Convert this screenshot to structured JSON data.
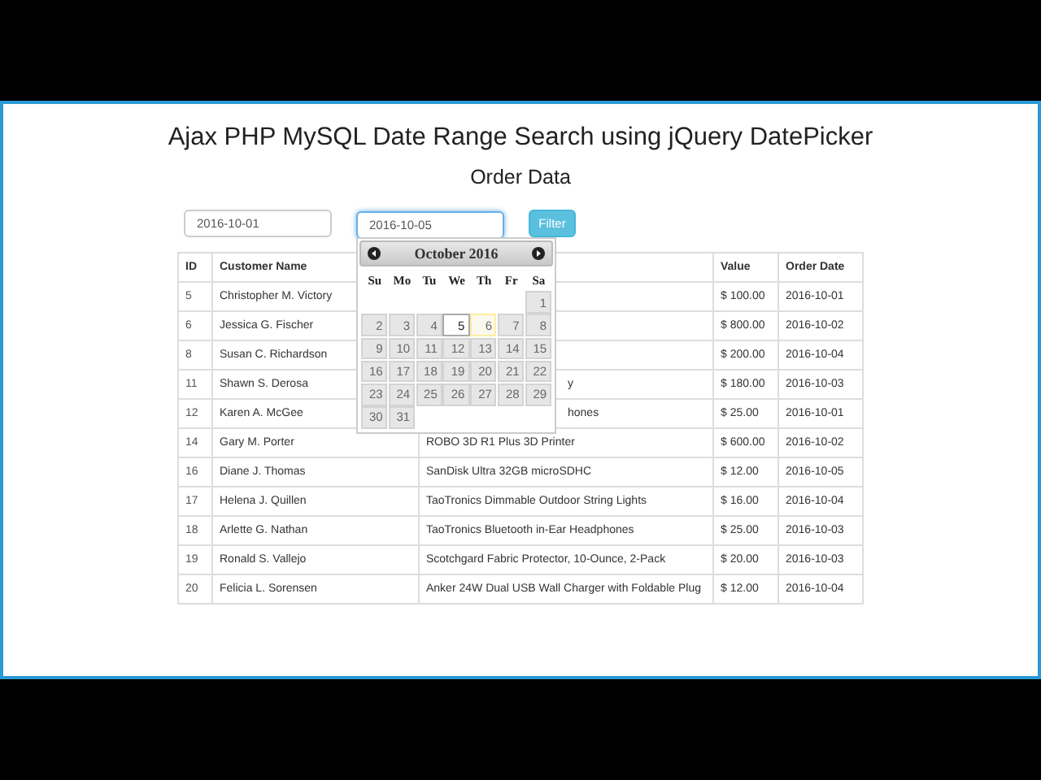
{
  "title": "Ajax PHP MySQL Date Range Search using jQuery DatePicker",
  "subtitle": "Order Data",
  "filter": {
    "from": {
      "value": "2016-10-01",
      "focused": false
    },
    "to": {
      "value": "2016-10-05",
      "focused": true
    },
    "button": "Filter"
  },
  "table": {
    "columns": [
      "ID",
      "Customer Name",
      "Value",
      "Order Date"
    ],
    "rows": [
      {
        "id": "5",
        "customer": "Christopher M. Victory",
        "value": "$ 100.00",
        "date": "2016-10-01"
      },
      {
        "id": "6",
        "customer": "Jessica G. Fischer",
        "value": "$ 800.00",
        "date": "2016-10-02"
      },
      {
        "id": "8",
        "customer": "Susan C. Richardson",
        "value": "$ 200.00",
        "date": "2016-10-04"
      },
      {
        "id": "11",
        "customer": "Shawn S. Derosa",
        "product_fragment": "y",
        "value": "$ 180.00",
        "date": "2016-10-03"
      },
      {
        "id": "12",
        "customer": "Karen A. McGee",
        "product_fragment": "hones",
        "value": "$ 25.00",
        "date": "2016-10-01"
      },
      {
        "id": "14",
        "customer": "Gary M. Porter",
        "product": "ROBO 3D R1 Plus 3D Printer",
        "value": "$ 600.00",
        "date": "2016-10-02"
      },
      {
        "id": "16",
        "customer": "Diane J. Thomas",
        "product": "SanDisk Ultra 32GB microSDHC",
        "value": "$ 12.00",
        "date": "2016-10-05"
      },
      {
        "id": "17",
        "customer": "Helena J. Quillen",
        "product": "TaoTronics Dimmable Outdoor String Lights",
        "value": "$ 16.00",
        "date": "2016-10-04"
      },
      {
        "id": "18",
        "customer": "Arlette G. Nathan",
        "product": "TaoTronics Bluetooth in-Ear Headphones",
        "value": "$ 25.00",
        "date": "2016-10-03"
      },
      {
        "id": "19",
        "customer": "Ronald S. Vallejo",
        "product": "Scotchgard Fabric Protector, 10-Ounce, 2-Pack",
        "value": "$ 20.00",
        "date": "2016-10-03"
      },
      {
        "id": "20",
        "customer": "Felicia L. Sorensen",
        "product": "Anker 24W Dual USB Wall Charger with Foldable Plug",
        "value": "$ 12.00",
        "date": "2016-10-04"
      }
    ]
  },
  "datepicker": {
    "month": "October 2016",
    "weekdays": [
      "Su",
      "Mo",
      "Tu",
      "We",
      "Th",
      "Fr",
      "Sa"
    ],
    "weeks": [
      {
        "days": [
          {
            "label": "1",
            "selected": false,
            "today": false
          }
        ]
      },
      {
        "days": [
          {
            "label": "2",
            "selected": false,
            "today": false
          },
          {
            "label": "3",
            "selected": false,
            "today": false
          },
          {
            "label": "4",
            "selected": false,
            "today": false
          },
          {
            "label": "5",
            "selected": true,
            "today": false
          },
          {
            "label": "6",
            "selected": false,
            "today": true
          },
          {
            "label": "7",
            "selected": false,
            "today": false
          },
          {
            "label": "8",
            "selected": false,
            "today": false
          }
        ]
      },
      {
        "days": [
          {
            "label": "9",
            "selected": false,
            "today": false
          },
          {
            "label": "10",
            "selected": false,
            "today": false
          },
          {
            "label": "11",
            "selected": false,
            "today": false
          },
          {
            "label": "12",
            "selected": false,
            "today": false
          },
          {
            "label": "13",
            "selected": false,
            "today": false
          },
          {
            "label": "14",
            "selected": false,
            "today": false
          },
          {
            "label": "15",
            "selected": false,
            "today": false
          }
        ]
      },
      {
        "days": [
          {
            "label": "16",
            "selected": false,
            "today": false
          },
          {
            "label": "17",
            "selected": false,
            "today": false
          },
          {
            "label": "18",
            "selected": false,
            "today": false
          },
          {
            "label": "19",
            "selected": false,
            "today": false
          },
          {
            "label": "20",
            "selected": false,
            "today": false
          },
          {
            "label": "21",
            "selected": false,
            "today": false
          },
          {
            "label": "22",
            "selected": false,
            "today": false
          }
        ]
      },
      {
        "days": [
          {
            "label": "23",
            "selected": false,
            "today": false
          },
          {
            "label": "24",
            "selected": false,
            "today": false
          },
          {
            "label": "25",
            "selected": false,
            "today": false
          },
          {
            "label": "26",
            "selected": false,
            "today": false
          },
          {
            "label": "27",
            "selected": false,
            "today": false
          },
          {
            "label": "28",
            "selected": false,
            "today": false
          },
          {
            "label": "29",
            "selected": false,
            "today": false
          }
        ]
      },
      {
        "days": [
          {
            "label": "30",
            "selected": false,
            "today": false
          },
          {
            "label": "31",
            "selected": false,
            "today": false
          }
        ]
      }
    ]
  }
}
